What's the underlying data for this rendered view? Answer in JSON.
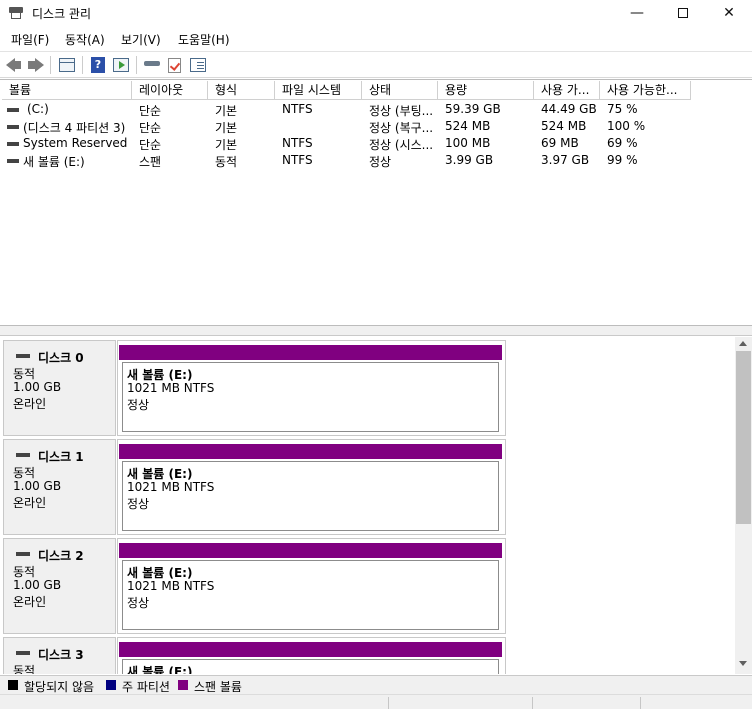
{
  "window": {
    "title": "디스크 관리",
    "minimize": "—",
    "close": "✕"
  },
  "menu": [
    "파일(F)",
    "동작(A)",
    "보기(V)",
    "도움말(H)"
  ],
  "toolbar": {
    "icons": [
      "back-arrow-icon",
      "forward-arrow-icon",
      "disk-list-icon",
      "help-icon",
      "play-view-icon",
      "connect-icon",
      "check-icon",
      "properties-icon"
    ],
    "help_glyph": "?"
  },
  "volume_table": {
    "headers": [
      "볼륨",
      "레이아웃",
      "형식",
      "파일 시스템",
      "상태",
      "용량",
      "사용 가...",
      "사용 가능한..."
    ],
    "rows": [
      [
        "(C:)",
        "단순",
        "기본",
        "NTFS",
        "정상 (부팅...",
        "59.39 GB",
        "44.49 GB",
        "75 %"
      ],
      [
        "(디스크 4 파티션 3)",
        "단순",
        "기본",
        "",
        "정상 (복구...",
        "524 MB",
        "524 MB",
        "100 %"
      ],
      [
        "System Reserved",
        "단순",
        "기본",
        "NTFS",
        "정상 (시스...",
        "100 MB",
        "69 MB",
        "69 %"
      ],
      [
        "새 볼륨 (E:)",
        "스팬",
        "동적",
        "NTFS",
        "정상",
        "3.99 GB",
        "3.97 GB",
        "99 %"
      ]
    ]
  },
  "disks": [
    {
      "name": "디스크 0",
      "type": "동적",
      "size": "1.00 GB",
      "state": "온라인",
      "volume": {
        "name": "새 볼륨  (E:)",
        "size": "1021 MB NTFS",
        "state": "정상"
      }
    },
    {
      "name": "디스크 1",
      "type": "동적",
      "size": "1.00 GB",
      "state": "온라인",
      "volume": {
        "name": "새 볼륨  (E:)",
        "size": "1021 MB NTFS",
        "state": "정상"
      }
    },
    {
      "name": "디스크 2",
      "type": "동적",
      "size": "1.00 GB",
      "state": "온라인",
      "volume": {
        "name": "새 볼륨  (E:)",
        "size": "1021 MB NTFS",
        "state": "정상"
      }
    },
    {
      "name": "디스크 3",
      "type": "동적",
      "size": "",
      "state": "",
      "volume": {
        "name": "새 볼륨  (E:)",
        "size": "",
        "state": ""
      }
    }
  ],
  "legend": [
    {
      "label": "할당되지 않음",
      "color": "#000000"
    },
    {
      "label": "주 파티션",
      "color": "#000080"
    },
    {
      "label": "스팬 볼륨",
      "color": "#800080"
    }
  ],
  "colors": {
    "spanned_volume": "#800080"
  }
}
